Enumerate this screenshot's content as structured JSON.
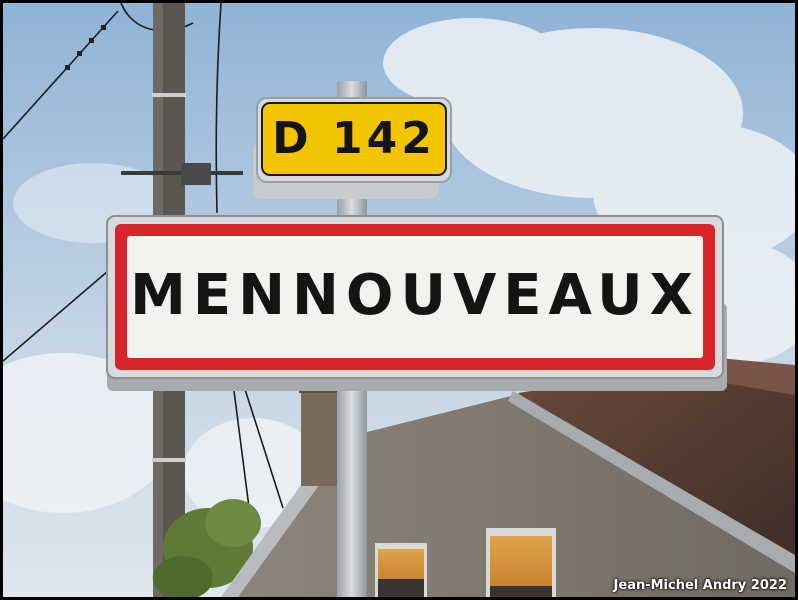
{
  "scene": {
    "road_sign": {
      "label": "D 142",
      "color": "#f2c500"
    },
    "town_sign": {
      "name": "MENNOUVEAUX",
      "border_color": "#d8242b"
    },
    "credit": "Jean-Michel Andry 2022"
  }
}
